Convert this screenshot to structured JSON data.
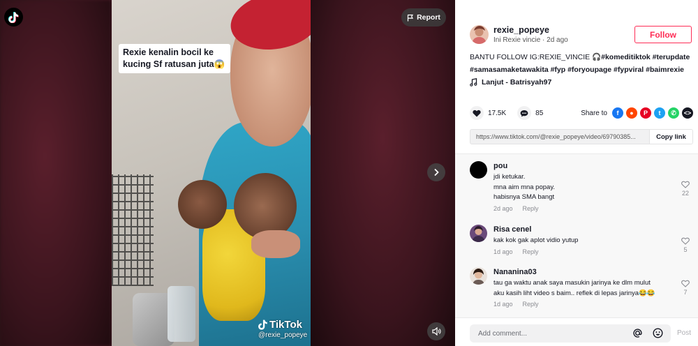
{
  "video": {
    "caption": "Rexie kenalin bocil ke kucing Sf ratusan juta😱",
    "report_label": "Report",
    "watermark_brand": "TikTok",
    "watermark_user": "@rexie_popeye"
  },
  "author": {
    "username": "rexie_popeye",
    "subtitle": "Ini Rexie vincie · 2d ago",
    "follow_label": "Follow"
  },
  "description": {
    "line1_text": "BANTU FOLLOW IG:REXIE_VINCIE 🎧",
    "line1_tags": "#komeditiktok #terupdate",
    "line2_tags": "#samasamaketawakita #fyp #foryoupage #fyp",
    "line2_tail": "viral #baimrexie"
  },
  "music": "Lanjut - Batrisyah97",
  "stats": {
    "likes": "17.5K",
    "comments": "85",
    "share_label": "Share to"
  },
  "share_icons": [
    {
      "name": "facebook-icon",
      "color": "#1877f2",
      "glyph": "f"
    },
    {
      "name": "reddit-icon",
      "color": "#ff4500",
      "glyph": "●"
    },
    {
      "name": "pinterest-icon",
      "color": "#e60023",
      "glyph": "P"
    },
    {
      "name": "twitter-icon",
      "color": "#1da1f2",
      "glyph": "t"
    },
    {
      "name": "whatsapp-icon",
      "color": "#25d366",
      "glyph": "✆"
    },
    {
      "name": "embed-icon",
      "color": "#161823",
      "glyph": "<>"
    }
  ],
  "link": {
    "url": "https://www.tiktok.com/@rexie_popeye/video/69790385...",
    "copy_label": "Copy link"
  },
  "comments": [
    {
      "name": "pou",
      "text": "jdi ketukar.\nmna aim mna popay.\nhabisnya SMA bangt",
      "time": "2d ago",
      "reply": "Reply",
      "likes": "22"
    },
    {
      "name": "Risa cenel",
      "text": "kak kok gak aplot vidio yutup",
      "time": "1d ago",
      "reply": "Reply",
      "likes": "5"
    },
    {
      "name": "Nananina03",
      "text": "tau ga waktu anak saya masukin jarinya ke dlm mulut\naku kasih liht video s baim.. reflek di lepas jarinya😂😂",
      "time": "1d ago",
      "reply": "Reply",
      "likes": "7"
    }
  ],
  "add_comment": {
    "placeholder": "Add comment...",
    "post_label": "Post"
  }
}
